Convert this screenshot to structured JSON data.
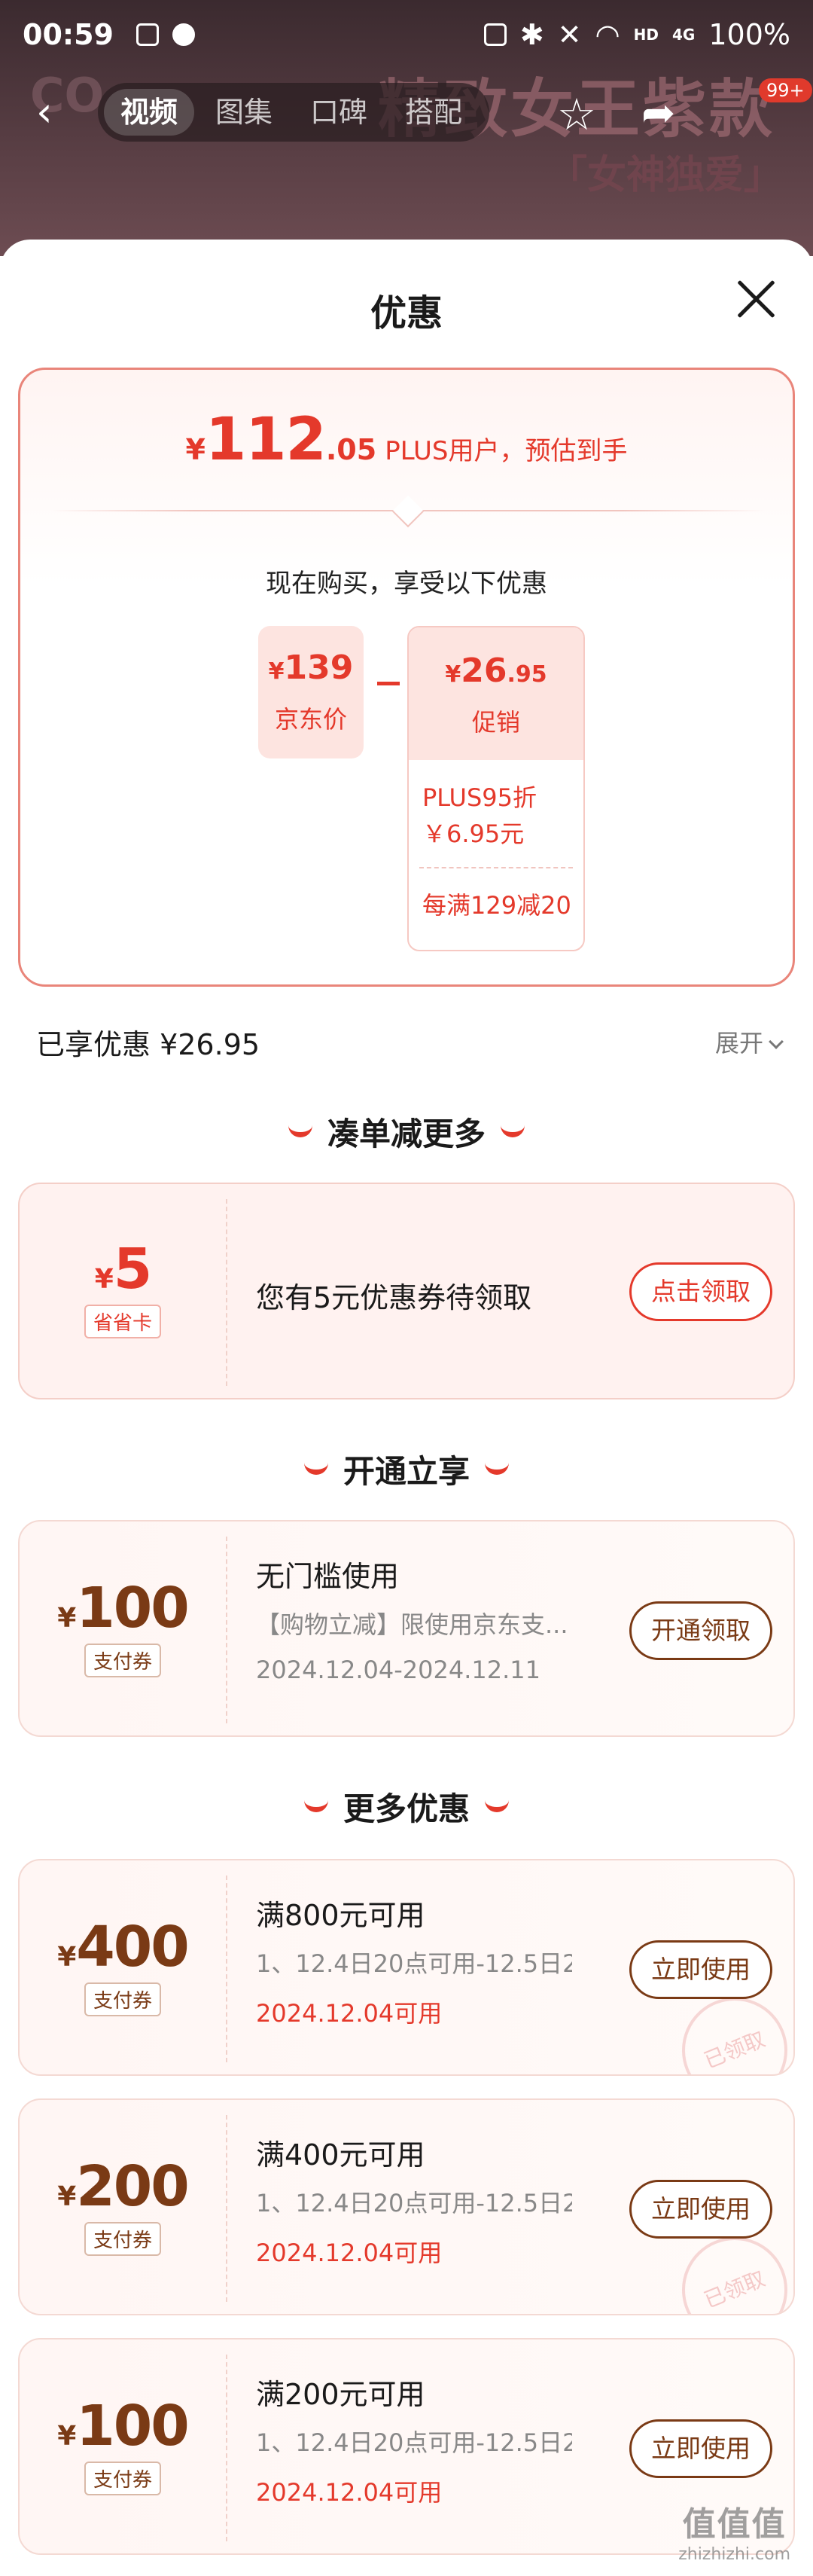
{
  "status_bar": {
    "time": "00:59",
    "network": "4G",
    "battery": "100%"
  },
  "background": {
    "title_fragment": "精致女王紫款",
    "subtitle": "「女神独爱」"
  },
  "nav": {
    "tabs": [
      "视频",
      "图集",
      "口碑",
      "搭配"
    ],
    "active_tab": "视频",
    "badge": "99+"
  },
  "sheet": {
    "title": "优惠"
  },
  "price_summary": {
    "currency": "¥",
    "price_int": "112",
    "price_dec": ".05",
    "price_desc": "PLUS用户，预估到手",
    "subheading": "现在购买，享受以下优惠",
    "jd_price": {
      "currency": "¥",
      "amount": "139",
      "label": "京东价"
    },
    "promo": {
      "currency": "¥",
      "amount_int": "26",
      "amount_dec": ".95",
      "label": "促销",
      "item1_line1": "PLUS95折",
      "item1_line2": "￥6.95元",
      "item2": "每满129减20"
    }
  },
  "enjoyed": {
    "text": "已享优惠 ¥26.95",
    "expand_label": "展开"
  },
  "sections": {
    "combine": "凑单减更多",
    "activate": "开通立享",
    "more": "更多优惠"
  },
  "coupons": {
    "savings_card": {
      "currency": "¥",
      "value": "5",
      "tag": "省省卡",
      "title": "您有5元优惠券待领取",
      "button": "点击领取"
    },
    "payment_100_activate": {
      "currency": "¥",
      "value": "100",
      "tag": "支付券",
      "title": "无门槛使用",
      "desc": "【购物立减】限使用京东支...",
      "date": "2024.12.04-2024.12.11",
      "button": "开通领取"
    },
    "list": [
      {
        "currency": "¥",
        "value": "400",
        "tag": "支付券",
        "title": "满800元可用",
        "desc": "1、12.4日20点可用-12.5日2...",
        "date": "2024.12.04可用",
        "button": "立即使用",
        "stamp": "已领取"
      },
      {
        "currency": "¥",
        "value": "200",
        "tag": "支付券",
        "title": "满400元可用",
        "desc": "1、12.4日20点可用-12.5日2...",
        "date": "2024.12.04可用",
        "button": "立即使用",
        "stamp": "已领取"
      },
      {
        "currency": "¥",
        "value": "100",
        "tag": "支付券",
        "title": "满200元可用",
        "desc": "1、12.4日20点可用-12.5日2...",
        "date": "2024.12.04可用",
        "button": "立即使用",
        "stamp": ""
      }
    ]
  },
  "watermark": {
    "logo": "值值值",
    "url": "zhizhizhi.com"
  },
  "colors": {
    "accent_red": "#e4392b",
    "coupon_brown": "#7a3a15"
  }
}
